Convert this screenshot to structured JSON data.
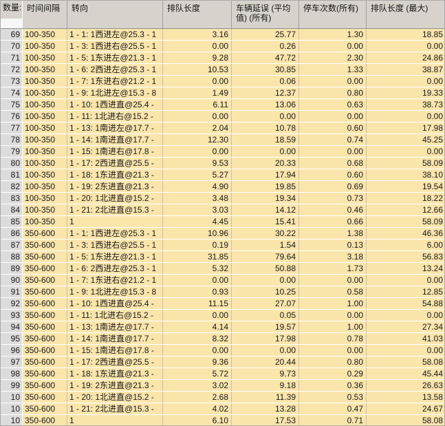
{
  "table": {
    "count_label": "数量:",
    "columns": [
      "时间间隔",
      "转向",
      "排队长度",
      "车辆延误 (平均值) (所有)",
      "停车次数(所有)",
      "排队长度 (最大)"
    ],
    "rows": [
      {
        "num": "69",
        "interval": "100-350",
        "turn": "1 - 1: 1西进左@25.3 - 1",
        "queue": "3.16",
        "delay": "25.77",
        "stops": "1.30",
        "qmax": "18.85"
      },
      {
        "num": "70",
        "interval": "100-350",
        "turn": "1 - 3: 1西进右@25.5 - 1",
        "queue": "0.00",
        "delay": "0.26",
        "stops": "0.00",
        "qmax": "0.00"
      },
      {
        "num": "71",
        "interval": "100-350",
        "turn": "1 - 5: 1东进左@21.3 - 1",
        "queue": "9.28",
        "delay": "47.72",
        "stops": "2.30",
        "qmax": "24.86"
      },
      {
        "num": "72",
        "interval": "100-350",
        "turn": "1 - 6: 2西进左@25.3 - 1",
        "queue": "10.53",
        "delay": "30.85",
        "stops": "1.33",
        "qmax": "38.87"
      },
      {
        "num": "73",
        "interval": "100-350",
        "turn": "1 - 7: 1东进右@21.2 - 1",
        "queue": "0.00",
        "delay": "0.06",
        "stops": "0.00",
        "qmax": "0.00"
      },
      {
        "num": "74",
        "interval": "100-350",
        "turn": "1 - 9: 1北进左@15.3 - 8",
        "queue": "1.49",
        "delay": "12.37",
        "stops": "0.80",
        "qmax": "19.33"
      },
      {
        "num": "75",
        "interval": "100-350",
        "turn": "1 - 10: 1西进直@25.4 -",
        "queue": "6.11",
        "delay": "13.06",
        "stops": "0.63",
        "qmax": "38.73"
      },
      {
        "num": "76",
        "interval": "100-350",
        "turn": "1 - 11: 1北进右@15.2 -",
        "queue": "0.00",
        "delay": "0.00",
        "stops": "0.00",
        "qmax": "0.00"
      },
      {
        "num": "77",
        "interval": "100-350",
        "turn": "1 - 13: 1南进左@17.7 -",
        "queue": "2.04",
        "delay": "10.78",
        "stops": "0.60",
        "qmax": "17.98"
      },
      {
        "num": "78",
        "interval": "100-350",
        "turn": "1 - 14: 1南进直@17.7 -",
        "queue": "12.30",
        "delay": "18.59",
        "stops": "0.74",
        "qmax": "45.25"
      },
      {
        "num": "79",
        "interval": "100-350",
        "turn": "1 - 15: 1南进右@17.8 -",
        "queue": "0.00",
        "delay": "0.00",
        "stops": "0.00",
        "qmax": "0.00"
      },
      {
        "num": "80",
        "interval": "100-350",
        "turn": "1 - 17: 2西进直@25.5 -",
        "queue": "9.53",
        "delay": "20.33",
        "stops": "0.68",
        "qmax": "58.09"
      },
      {
        "num": "81",
        "interval": "100-350",
        "turn": "1 - 18: 1东进直@21.3 -",
        "queue": "5.27",
        "delay": "17.94",
        "stops": "0.60",
        "qmax": "38.10"
      },
      {
        "num": "82",
        "interval": "100-350",
        "turn": "1 - 19: 2东进直@21.3 -",
        "queue": "4.90",
        "delay": "19.85",
        "stops": "0.69",
        "qmax": "19.54"
      },
      {
        "num": "83",
        "interval": "100-350",
        "turn": "1 - 20: 1北进直@15.2 -",
        "queue": "3.48",
        "delay": "19.34",
        "stops": "0.73",
        "qmax": "18.22"
      },
      {
        "num": "84",
        "interval": "100-350",
        "turn": "1 - 21: 2北进直@15.3 -",
        "queue": "3.03",
        "delay": "14.12",
        "stops": "0.46",
        "qmax": "12.66"
      },
      {
        "num": "85",
        "interval": "100-350",
        "turn": "1",
        "queue": "4.45",
        "delay": "15.41",
        "stops": "0.66",
        "qmax": "58.09"
      },
      {
        "num": "86",
        "interval": "350-600",
        "turn": "1 - 1: 1西进左@25.3 - 1",
        "queue": "10.96",
        "delay": "30.22",
        "stops": "1.38",
        "qmax": "46.36"
      },
      {
        "num": "87",
        "interval": "350-600",
        "turn": "1 - 3: 1西进右@25.5 - 1",
        "queue": "0.19",
        "delay": "1.54",
        "stops": "0.13",
        "qmax": "6.00"
      },
      {
        "num": "88",
        "interval": "350-600",
        "turn": "1 - 5: 1东进左@21.3 - 1",
        "queue": "31.85",
        "delay": "79.64",
        "stops": "3.18",
        "qmax": "56.83"
      },
      {
        "num": "89",
        "interval": "350-600",
        "turn": "1 - 6: 2西进左@25.3 - 1",
        "queue": "5.32",
        "delay": "50.88",
        "stops": "1.73",
        "qmax": "13.24"
      },
      {
        "num": "90",
        "interval": "350-600",
        "turn": "1 - 7: 1东进右@21.2 - 1",
        "queue": "0.00",
        "delay": "0.00",
        "stops": "0.00",
        "qmax": "0.00"
      },
      {
        "num": "91",
        "interval": "350-600",
        "turn": "1 - 9: 1北进左@15.3 - 8",
        "queue": "0.93",
        "delay": "10.25",
        "stops": "0.58",
        "qmax": "12.85"
      },
      {
        "num": "92",
        "interval": "350-600",
        "turn": "1 - 10: 1西进直@25.4 -",
        "queue": "11.15",
        "delay": "27.07",
        "stops": "1.00",
        "qmax": "54.88"
      },
      {
        "num": "93",
        "interval": "350-600",
        "turn": "1 - 11: 1北进右@15.2 -",
        "queue": "0.00",
        "delay": "0.05",
        "stops": "0.00",
        "qmax": "0.00"
      },
      {
        "num": "94",
        "interval": "350-600",
        "turn": "1 - 13: 1南进左@17.7 -",
        "queue": "4.14",
        "delay": "19.57",
        "stops": "1.00",
        "qmax": "27.34"
      },
      {
        "num": "95",
        "interval": "350-600",
        "turn": "1 - 14: 1南进直@17.7 -",
        "queue": "8.32",
        "delay": "17.98",
        "stops": "0.78",
        "qmax": "41.03"
      },
      {
        "num": "96",
        "interval": "350-600",
        "turn": "1 - 15: 1南进右@17.8 -",
        "queue": "0.00",
        "delay": "0.00",
        "stops": "0.00",
        "qmax": "0.00"
      },
      {
        "num": "97",
        "interval": "350-600",
        "turn": "1 - 17: 2西进直@25.5 -",
        "queue": "9.36",
        "delay": "20.44",
        "stops": "0.80",
        "qmax": "58.08"
      },
      {
        "num": "98",
        "interval": "350-600",
        "turn": "1 - 18: 1东进直@21.3 -",
        "queue": "5.72",
        "delay": "9.73",
        "stops": "0.29",
        "qmax": "45.44"
      },
      {
        "num": "99",
        "interval": "350-600",
        "turn": "1 - 19: 2东进直@21.3 -",
        "queue": "3.02",
        "delay": "9.18",
        "stops": "0.36",
        "qmax": "26.63"
      },
      {
        "num": "10",
        "interval": "350-600",
        "turn": "1 - 20: 1北进直@15.2 -",
        "queue": "2.68",
        "delay": "11.39",
        "stops": "0.53",
        "qmax": "13.58"
      },
      {
        "num": "10",
        "interval": "350-600",
        "turn": "1 - 21: 2北进直@15.3 -",
        "queue": "4.02",
        "delay": "13.28",
        "stops": "0.47",
        "qmax": "24.67"
      },
      {
        "num": "10",
        "interval": "350-600",
        "turn": "1",
        "queue": "6.10",
        "delay": "17.53",
        "stops": "0.71",
        "qmax": "58.08"
      }
    ]
  },
  "colors": {
    "cell_bg": "#fae5ab",
    "row_number_bg": "#dcdcdc",
    "header_bg": "#d7d3cc",
    "grid_line_vertical": "#c6bfae",
    "grid_line_horizontal": "#ffffff",
    "text": "#18181c"
  }
}
